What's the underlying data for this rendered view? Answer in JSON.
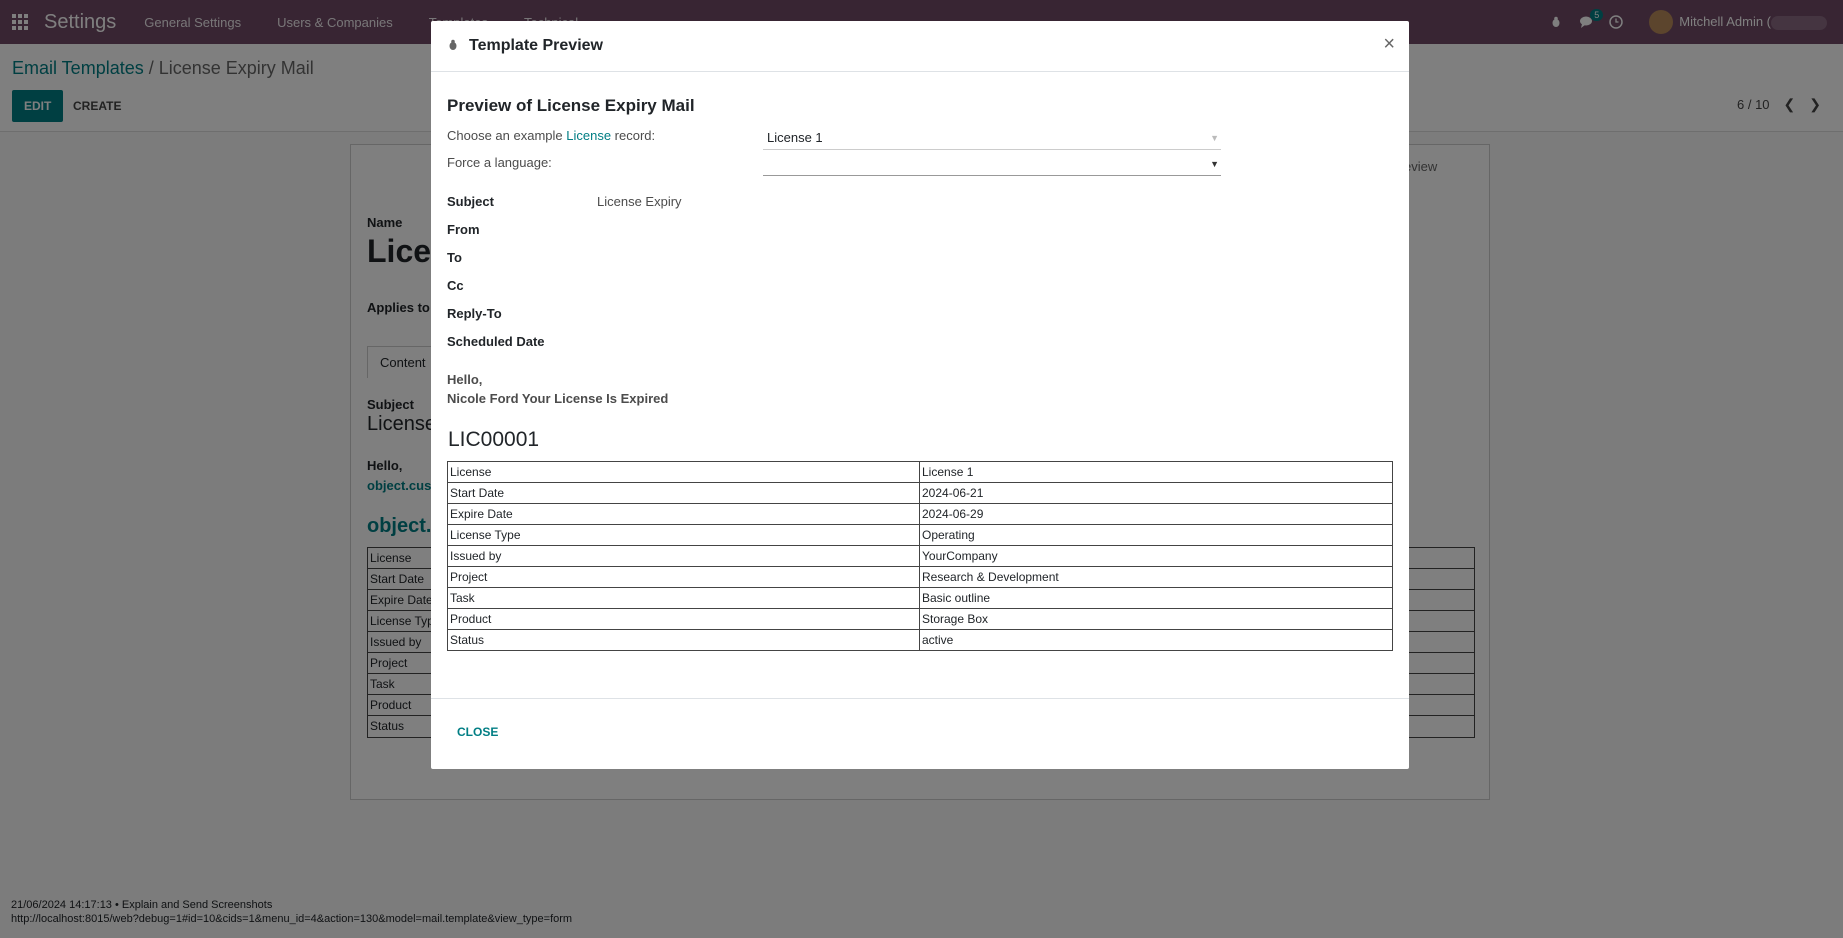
{
  "navbar": {
    "brand": "Settings",
    "menu": [
      "General Settings",
      "Users & Companies",
      "Templates",
      "Technical"
    ],
    "messages_badge": "5",
    "user_name": "Mitchell Admin (",
    "icons": [
      "apps-grid-icon",
      "bug-icon",
      "chat-icon",
      "clock-icon"
    ]
  },
  "control_panel": {
    "breadcrumb_parent": "Email Templates",
    "breadcrumb_sep": " / ",
    "breadcrumb_current": "License Expiry Mail",
    "edit_label": "EDIT",
    "create_label": "CREATE",
    "pager_text": "6 / 10"
  },
  "background_form": {
    "name_label": "Name",
    "name_value": "Licen",
    "applies_to_label": "Applies to",
    "tab_content": "Content",
    "tab_preview_fragment": "eview",
    "subject_label": "Subject",
    "subject_value": "License",
    "hello": "Hello,",
    "object_cust": "object.cust",
    "object_heading": "object.l",
    "rows": [
      "License",
      "Start Date",
      "Expire Date",
      "License Typ",
      "Issued by",
      "Project",
      "Task",
      "Product",
      "Status"
    ]
  },
  "modal": {
    "title": "Template Preview",
    "close_symbol": "×",
    "preview_heading": "Preview of License Expiry Mail",
    "choose_prefix": "Choose an example ",
    "choose_link": "License",
    "choose_suffix": " record:",
    "record_value": "License 1",
    "force_language_label": "Force a language:",
    "language_value": "",
    "fields": {
      "subject_label": "Subject",
      "subject_value": "License Expiry",
      "from_label": "From",
      "to_label": "To",
      "cc_label": "Cc",
      "reply_to_label": "Reply-To",
      "scheduled_date_label": "Scheduled Date"
    },
    "body_hello": "Hello,",
    "body_line": "Nicole Ford Your License Is Expired",
    "license_ref": "LIC00001",
    "table": [
      [
        "License",
        "License 1"
      ],
      [
        "Start Date",
        "2024-06-21"
      ],
      [
        "Expire Date",
        "2024-06-29"
      ],
      [
        "License Type",
        "Operating"
      ],
      [
        "Issued by",
        "YourCompany"
      ],
      [
        "Project",
        "Research & Development"
      ],
      [
        "Task",
        "Basic outline"
      ],
      [
        "Product",
        "Storage Box"
      ],
      [
        "Status",
        "active"
      ]
    ],
    "close_button": "CLOSE"
  },
  "status_bar": {
    "line1": "21/06/2024 14:17:13 • Explain and Send Screenshots",
    "line2": "http://localhost:8015/web?debug=1#id=10&cids=1&menu_id=4&action=130&model=mail.template&view_type=form"
  },
  "colors": {
    "navbar": "#714B67",
    "accent": "#017e84"
  }
}
